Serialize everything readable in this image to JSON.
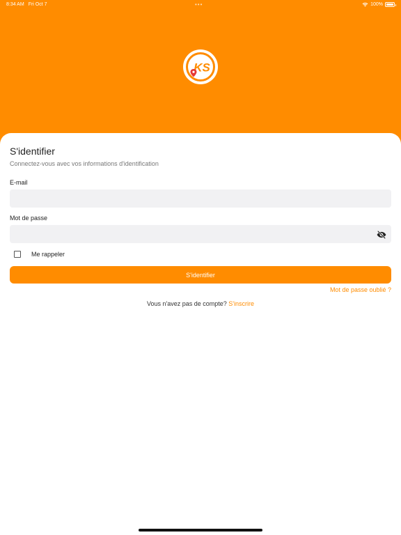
{
  "status_bar": {
    "time": "8:34 AM",
    "date": "Fri Oct 7",
    "battery": "100%",
    "icons": [
      "wifi-icon",
      "battery-icon"
    ]
  },
  "logo": {
    "text": "KS",
    "icon": "location-pin-icon"
  },
  "login": {
    "title": "S'identifier",
    "subtitle": "Connectez-vous avec vos informations d'identification",
    "email_label": "E-mail",
    "email_value": "",
    "password_label": "Mot de passe",
    "password_value": "",
    "password_icon": "eye-off-icon",
    "remember_label": "Me rappeler",
    "remember_checked": false,
    "submit_label": "S'identifier",
    "forgot_label": "Mot de passe oublié ?",
    "no_account_text": "Vous n'avez pas de compte?",
    "signup_label": "S'inscrire"
  },
  "colors": {
    "brand": "#ff8c00",
    "field_bg": "#f1f1f3",
    "card_bg": "#ffffff"
  }
}
